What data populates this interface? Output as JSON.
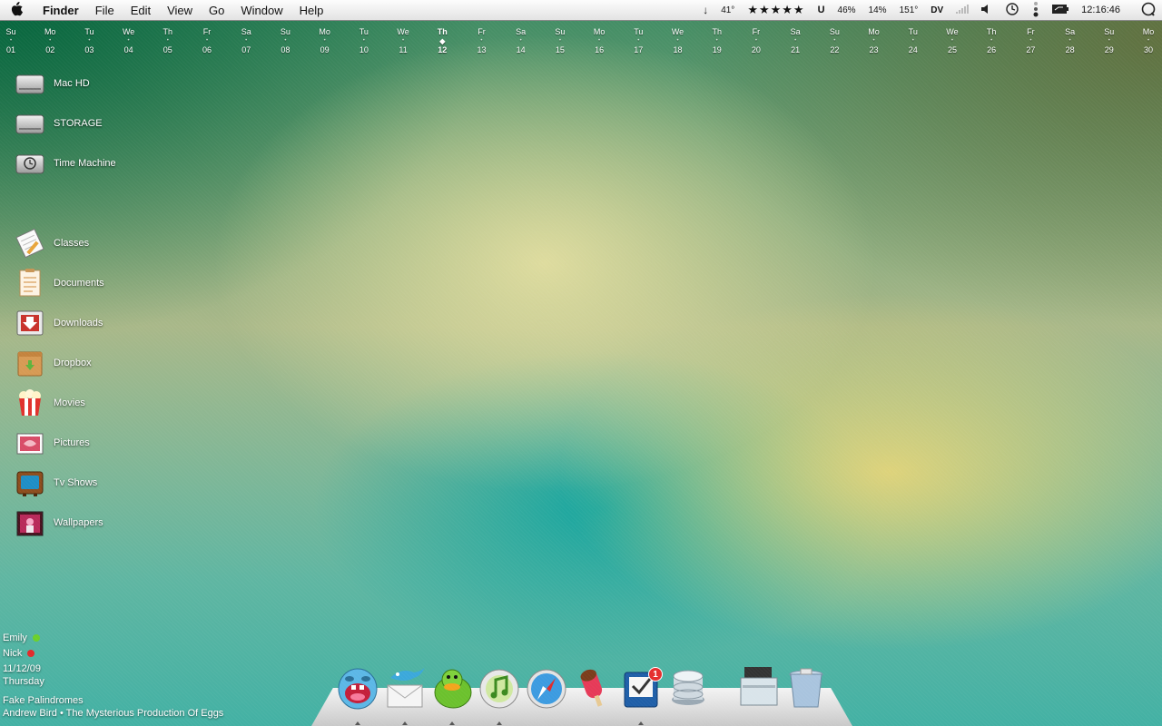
{
  "menubar": {
    "apple_label": "",
    "items": [
      "Finder",
      "File",
      "Edit",
      "View",
      "Go",
      "Window",
      "Help"
    ],
    "status": {
      "download_arrow": "↓",
      "temperature": "41°",
      "rating": "★★★★★",
      "meter1": "46%",
      "meter2": "14%",
      "meter3": "151°",
      "dv": "DV",
      "clock": "12:16:46"
    }
  },
  "calendar": {
    "days": [
      {
        "dn": "Su",
        "num": "01"
      },
      {
        "dn": "Mo",
        "num": "02"
      },
      {
        "dn": "Tu",
        "num": "03"
      },
      {
        "dn": "We",
        "num": "04"
      },
      {
        "dn": "Th",
        "num": "05"
      },
      {
        "dn": "Fr",
        "num": "06"
      },
      {
        "dn": "Sa",
        "num": "07"
      },
      {
        "dn": "Su",
        "num": "08"
      },
      {
        "dn": "Mo",
        "num": "09"
      },
      {
        "dn": "Tu",
        "num": "10"
      },
      {
        "dn": "We",
        "num": "11"
      },
      {
        "dn": "Th",
        "num": "12"
      },
      {
        "dn": "Fr",
        "num": "13"
      },
      {
        "dn": "Sa",
        "num": "14"
      },
      {
        "dn": "Su",
        "num": "15"
      },
      {
        "dn": "Mo",
        "num": "16"
      },
      {
        "dn": "Tu",
        "num": "17"
      },
      {
        "dn": "We",
        "num": "18"
      },
      {
        "dn": "Th",
        "num": "19"
      },
      {
        "dn": "Fr",
        "num": "20"
      },
      {
        "dn": "Sa",
        "num": "21"
      },
      {
        "dn": "Su",
        "num": "22"
      },
      {
        "dn": "Mo",
        "num": "23"
      },
      {
        "dn": "Tu",
        "num": "24"
      },
      {
        "dn": "We",
        "num": "25"
      },
      {
        "dn": "Th",
        "num": "26"
      },
      {
        "dn": "Fr",
        "num": "27"
      },
      {
        "dn": "Sa",
        "num": "28"
      },
      {
        "dn": "Su",
        "num": "29"
      },
      {
        "dn": "Mo",
        "num": "30"
      }
    ],
    "today": "12"
  },
  "desktop": {
    "drives": [
      {
        "label": "Mac HD",
        "icon": "hard-drive-icon"
      },
      {
        "label": "STORAGE",
        "icon": "hard-drive-icon"
      },
      {
        "label": "Time Machine",
        "icon": "time-machine-drive-icon"
      }
    ],
    "folders": [
      {
        "label": "Classes",
        "icon": "notebook-icon"
      },
      {
        "label": "Documents",
        "icon": "document-icon"
      },
      {
        "label": "Downloads",
        "icon": "downloads-icon"
      },
      {
        "label": "Dropbox",
        "icon": "dropbox-box-icon"
      },
      {
        "label": "Movies",
        "icon": "popcorn-icon"
      },
      {
        "label": "Pictures",
        "icon": "photo-icon"
      },
      {
        "label": "Tv Shows",
        "icon": "tv-icon"
      },
      {
        "label": "Wallpapers",
        "icon": "wallpaper-icon"
      }
    ]
  },
  "widget": {
    "buddies": [
      {
        "name": "Emily",
        "status_color": "#6cd02a"
      },
      {
        "name": "Nick",
        "status_color": "#e22a2a"
      }
    ],
    "date": "11/12/09",
    "weekday": "Thursday",
    "song": "Fake Palindromes",
    "artist_album": "Andrew Bird • The Mysterious Production Of Eggs"
  },
  "dock": {
    "items": [
      {
        "icon": "adium-icon",
        "running": true
      },
      {
        "icon": "mail-bird-icon",
        "running": true
      },
      {
        "icon": "adium-duck-icon",
        "running": true
      },
      {
        "icon": "itunes-icon",
        "running": true
      },
      {
        "icon": "safari-icon",
        "running": false
      },
      {
        "icon": "popsicle-icon",
        "running": false
      },
      {
        "icon": "things-icon",
        "running": true,
        "badge": "1"
      },
      {
        "icon": "database-icon",
        "running": false
      },
      {
        "icon": "downloads-stack-icon",
        "running": false
      },
      {
        "icon": "trash-icon",
        "running": false
      }
    ]
  },
  "colors": {
    "menubar": "#e9e9e9",
    "badge": "#e52d2d"
  }
}
